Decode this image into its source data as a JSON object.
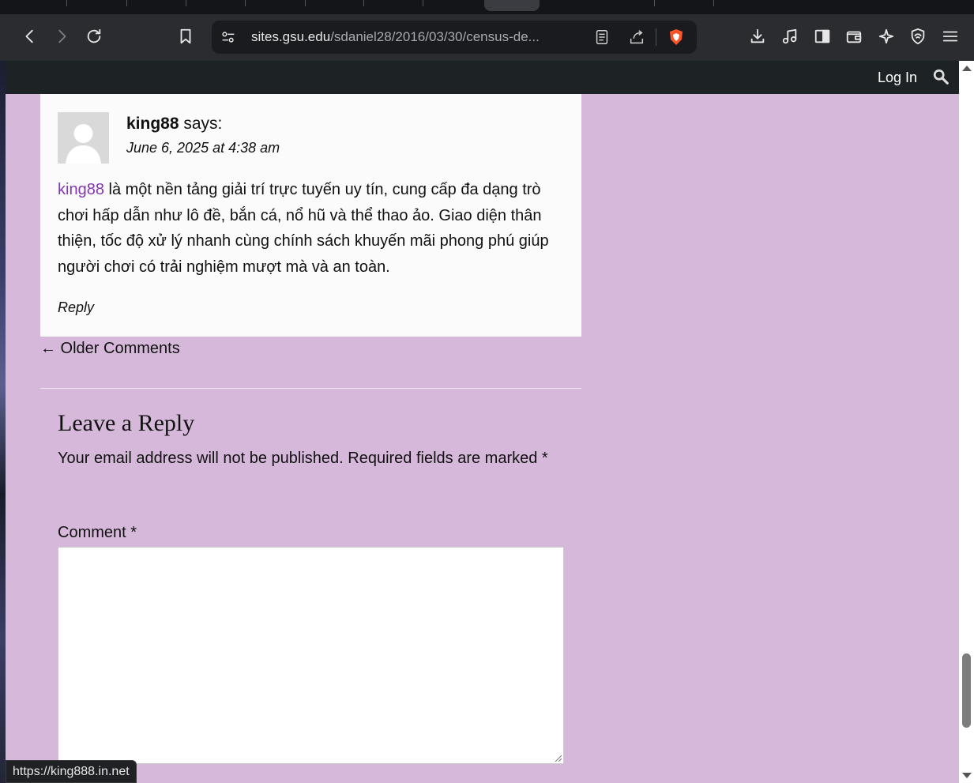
{
  "browser": {
    "url_host": "sites.gsu.edu",
    "url_path": "/sdaniel28/2016/03/30/census-de...",
    "status_link": "https://king888.in.net"
  },
  "site_header": {
    "login_label": "Log In"
  },
  "comment": {
    "author": "king88",
    "says": "says:",
    "date": "June 6, 2025 at 4:38 am",
    "link_text": "king88",
    "body": " là một nền tảng giải trí trực tuyến uy tín, cung cấp đa dạng trò chơi hấp dẫn như lô đề, bắn cá, nổ hũ và thể thao ảo. Giao diện thân thiện, tốc độ xử lý nhanh cùng chính sách khuyến mãi phong phú giúp người chơi có trải nghiệm mượt mà và an toàn.",
    "reply_label": "Reply"
  },
  "navigation": {
    "older_comments": "← Older Comments"
  },
  "reply_form": {
    "title": "Leave a Reply",
    "note": "Your email address will not be published. Required fields are marked *",
    "comment_label": "Comment *"
  },
  "colors": {
    "page_bg": "#d6b8da",
    "link": "#8237b3",
    "site_bar": "#1d2224"
  }
}
